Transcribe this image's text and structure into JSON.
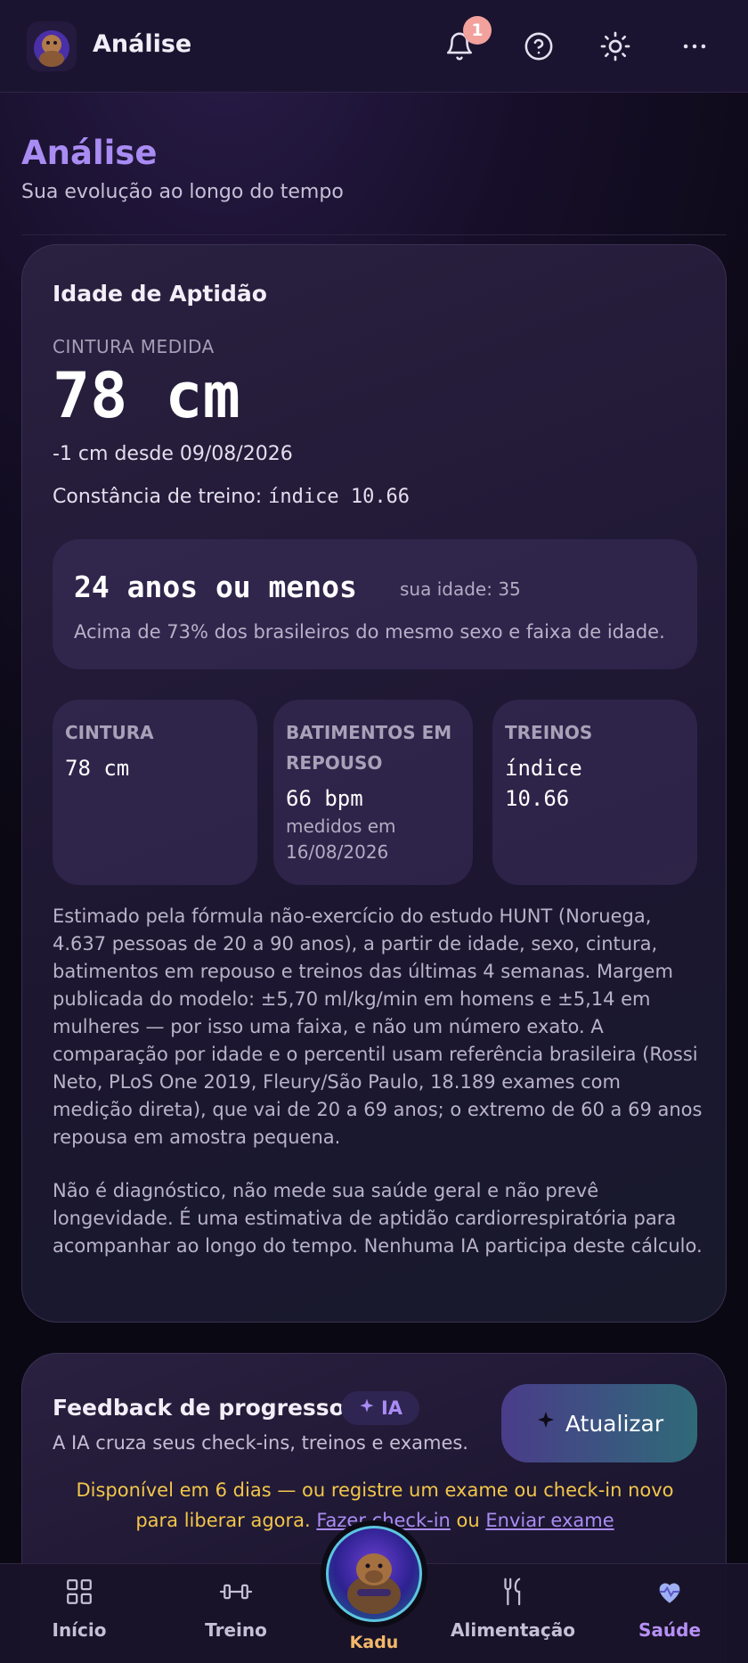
{
  "header": {
    "app_title": "Análise",
    "notification_count": "1",
    "icons": [
      "app-logo",
      "bell-icon",
      "help-icon",
      "theme-sun-icon",
      "more-icon"
    ]
  },
  "page": {
    "title": "Análise",
    "subtitle": "Sua evolução ao longo do tempo"
  },
  "fitness_card": {
    "title": "Idade de Aptidão",
    "measure_label": "CINTURA MEDIDA",
    "measure_value": "78 cm",
    "delta": "-1 cm desde 09/08/2026",
    "constancy_label": "Constância de treino:",
    "constancy_value": "índice 10.66",
    "age": {
      "main": "24 anos ou menos",
      "your_age": "sua idade: 35",
      "percentile": "Acima de 73% dos brasileiros do mesmo sexo e faixa de idade."
    },
    "stats": [
      {
        "label": "CINTURA",
        "value": "78 cm",
        "note": ""
      },
      {
        "label": "BATIMENTOS EM REPOUSO",
        "value": "66 bpm",
        "note": "medidos em 16/08/2026"
      },
      {
        "label": "TREINOS",
        "value": "índice 10.66",
        "note": ""
      }
    ],
    "method_text": "Estimado pela fórmula não-exercício do estudo HUNT (Noruega, 4.637 pessoas de 20 a 90 anos), a partir de idade, sexo, cintura, batimentos em repouso e treinos das últimas 4 semanas. Margem publicada do modelo: ±5,70 ml/kg/min em homens e ±5,14 em mulheres — por isso uma faixa, e não um número exato. A comparação por idade e o percentil usam referência brasileira (Rossi Neto, PLoS One 2019, Fleury/São Paulo, 18.189 exames com medição direta), que vai de 20 a 69 anos; o extremo de 60 a 69 anos repousa em amostra pequena.",
    "disclaimer": "Não é diagnóstico, não mede sua saúde geral e não prevê longevidade. É uma estimativa de aptidão cardiorrespiratória para acompanhar ao longo do tempo. Nenhuma IA participa deste cálculo."
  },
  "feedback_card": {
    "title": "Feedback de progresso",
    "ia_badge": "IA",
    "subtitle": "A IA cruza seus check-ins, treinos e exames.",
    "update_button": "Atualizar",
    "availability": "Disponível em 6 dias — ou registre um exame ou check-in novo para liberar agora.",
    "link_checkin": "Fazer check-in",
    "or": "ou",
    "link_exam": "Enviar exame"
  },
  "bottom_nav": {
    "items": [
      {
        "label": "Início",
        "icon": "grid-icon"
      },
      {
        "label": "Treino",
        "icon": "dumbbell-icon"
      },
      {
        "label": "Kadu",
        "icon": "kadu-avatar"
      },
      {
        "label": "Alimentação",
        "icon": "fork-knife-icon"
      },
      {
        "label": "Saúde",
        "icon": "heart-pulse-icon"
      }
    ],
    "active": "Saúde"
  },
  "colors": {
    "accent": "#a98cf3",
    "warning": "#f2c64a",
    "kadu": "#f3b86a",
    "badge": "#f2a19c"
  }
}
